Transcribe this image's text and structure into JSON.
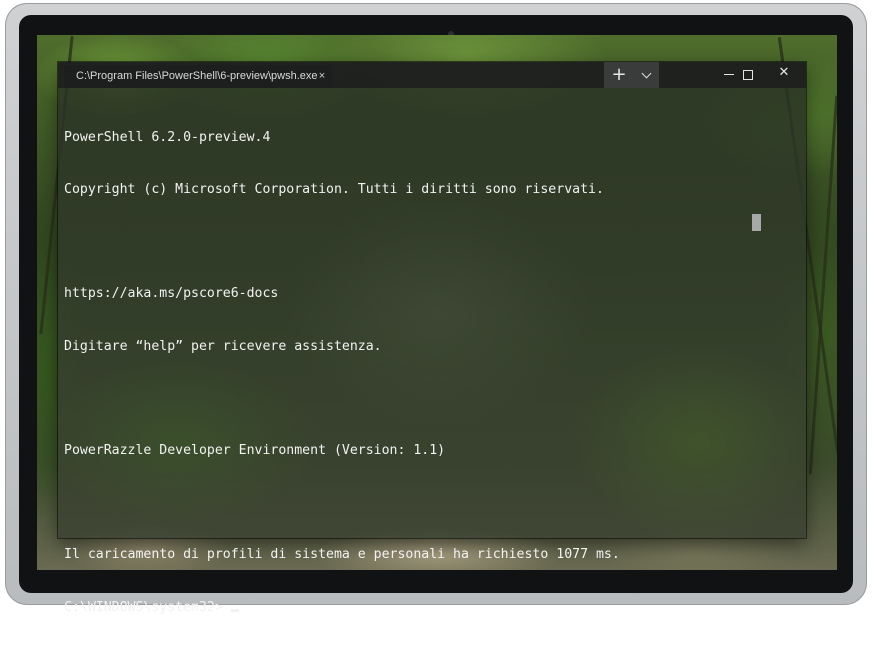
{
  "window": {
    "tab_title": "C:\\Program Files\\PowerShell\\6-preview\\pwsh.exe",
    "tab_close_glyph": "×",
    "new_tab_glyph": "+",
    "close_glyph": "✕"
  },
  "console": {
    "lines": [
      "PowerShell 6.2.0-preview.4",
      "Copyright (c) Microsoft Corporation. Tutti i diritti sono riservati.",
      "",
      "https://aka.ms/pscore6-docs",
      "Digitare “help” per ricevere assistenza.",
      "",
      "PowerRazzle Developer Environment (Version: 1.1)",
      "",
      "Il caricamento di profili di sistema e personali ha richiesto 1077 ms."
    ],
    "prompt": "C:\\WINDOWS\\system32> "
  },
  "icons": [
    "close-icon",
    "plus-icon",
    "chevron-down-icon",
    "minimize-icon",
    "maximize-icon"
  ],
  "colors": {
    "titlebar": "#1e201e",
    "tab_bg": "#1d1f1e",
    "text": "#f2f2f2",
    "device_frame": "#c4c6c8"
  }
}
